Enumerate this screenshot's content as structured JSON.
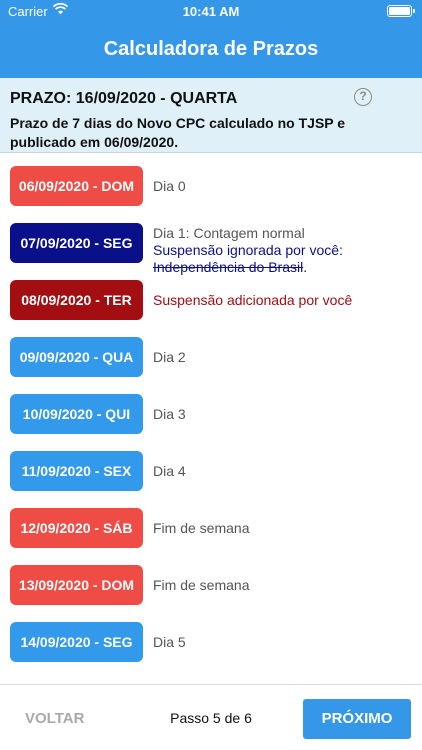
{
  "status_bar": {
    "carrier": "Carrier",
    "time": "10:41 AM",
    "battery_level": 1.0
  },
  "nav": {
    "title": "Calculadora de Prazos"
  },
  "header": {
    "prazo": "PRAZO: 16/09/2020 - QUARTA",
    "help_icon": "?",
    "description": "Prazo de 7 dias do Novo CPC calculado no TJSP e publicado em 06/09/2020."
  },
  "days": [
    {
      "date": "06/09/2020 - DOM",
      "color": "#ef4c45",
      "label": "Dia 0"
    },
    {
      "date": "07/09/2020 - SEG",
      "color": "#0a108a",
      "label": "Dia 1: Contagem normal",
      "label2": "Suspensão ignorada por você:",
      "label3": "Independência do Brasil",
      "label3_suffix": "."
    },
    {
      "date": "08/09/2020 - TER",
      "color": "#a20e12",
      "label": "Suspensão adicionada por você"
    },
    {
      "date": "09/09/2020 - QUA",
      "color": "#3399ea",
      "label": "Dia 2"
    },
    {
      "date": "10/09/2020 - QUI",
      "color": "#3399ea",
      "label": "Dia 3"
    },
    {
      "date": "11/09/2020 - SEX",
      "color": "#3399ea",
      "label": "Dia 4"
    },
    {
      "date": "12/09/2020 - SÁB",
      "color": "#ef4c45",
      "label": "Fim de semana"
    },
    {
      "date": "13/09/2020 - DOM",
      "color": "#ef4c45",
      "label": "Fim de semana"
    },
    {
      "date": "14/09/2020 - SEG",
      "color": "#3399ea",
      "label": "Dia 5"
    }
  ],
  "footer": {
    "back": "VOLTAR",
    "step": "Passo 5 de 6",
    "next": "PRÓXIMO"
  }
}
